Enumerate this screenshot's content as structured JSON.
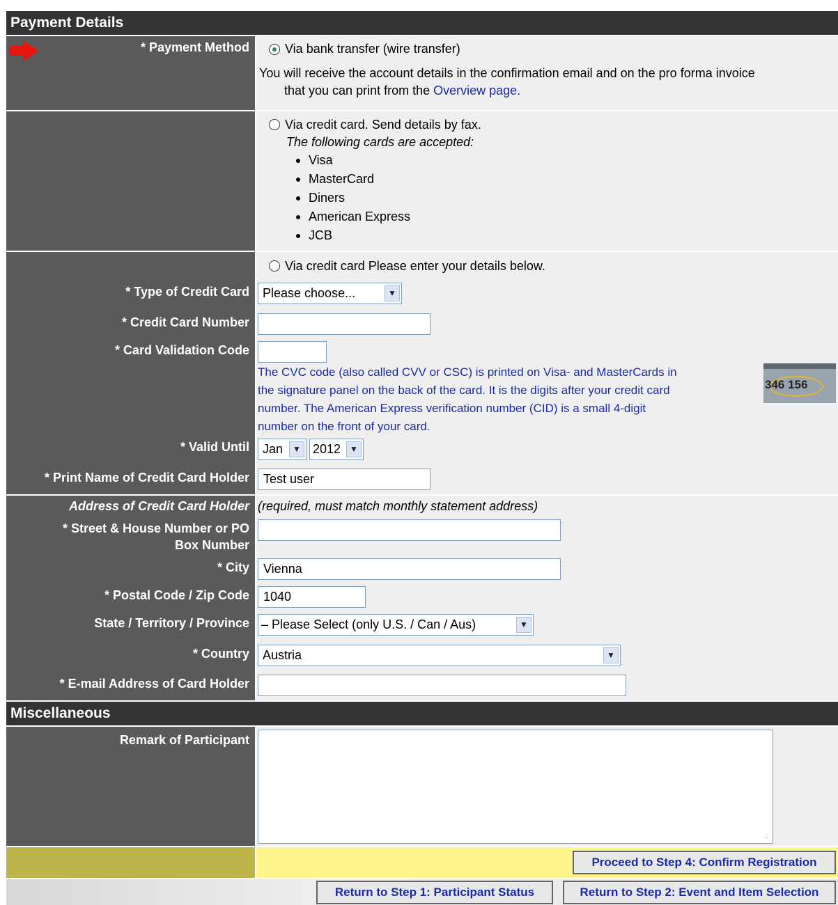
{
  "payment": {
    "header": "Payment Details",
    "method_label": "* Payment Method",
    "bank_option": "Via bank transfer (wire transfer)",
    "bank_note_1": "You will receive the account details in the confirmation email and on the pro forma invoice",
    "bank_note_2": "that you can print from the",
    "overview_link": "Overview page.",
    "fax_option": "Via credit card. Send details by fax.",
    "cards_intro": "The following cards are accepted:",
    "cards": [
      "Visa",
      "MasterCard",
      "Diners",
      "American Express",
      "JCB"
    ],
    "cc_option": "Via credit card Please enter your details below.",
    "type_label": "* Type of Credit Card",
    "type_value": "Please choose...",
    "number_label": "* Credit Card Number",
    "number_value": "",
    "cvc_label": "* Card Validation Code",
    "cvc_value": "",
    "cvc_help": [
      "The CVC code (also called CVV or CSC) is printed on Visa- and MasterCards in",
      "the signature panel on the back of the card. It is the digits after your credit card",
      "number. The American Express verification number (CID) is a small 4-digit",
      "number on the front of your card."
    ],
    "cvc_image_text": "346 156",
    "valid_label": "* Valid Until",
    "valid_month": "Jan",
    "valid_year": "2012",
    "holder_label": "* Print Name of Credit Card Holder",
    "holder_value": "Test user"
  },
  "address": {
    "heading": "Address of Credit Card Holder",
    "note": "(required, must match monthly statement address)",
    "street_label_1": "* Street & House Number or PO",
    "street_label_2": "Box Number",
    "street_value": "",
    "city_label": "* City",
    "city_value": "Vienna",
    "postal_label": "* Postal Code / Zip Code",
    "postal_value": "1040",
    "state_label": "State / Territory / Province",
    "state_value": "– Please Select (only U.S. / Can / Aus)",
    "country_label": "* Country",
    "country_value": "Austria",
    "email_label": "* E-mail Address of Card Holder",
    "email_value": ""
  },
  "misc": {
    "header": "Miscellaneous",
    "remark_label": "Remark of Participant",
    "remark_value": ""
  },
  "actions": {
    "proceed": "Proceed to Step 4: Confirm Registration",
    "return1": "Return to Step 1: Participant Status",
    "return2": "Return to Step 2: Event and Item Selection"
  },
  "colors": {
    "header_bg": "#333333",
    "label_bg": "#5a5a5a",
    "value_bg": "#efefef",
    "link": "#1a2aa8",
    "accent_arrow": "#e8150f",
    "proceed_row_bg": "#fff68f"
  }
}
